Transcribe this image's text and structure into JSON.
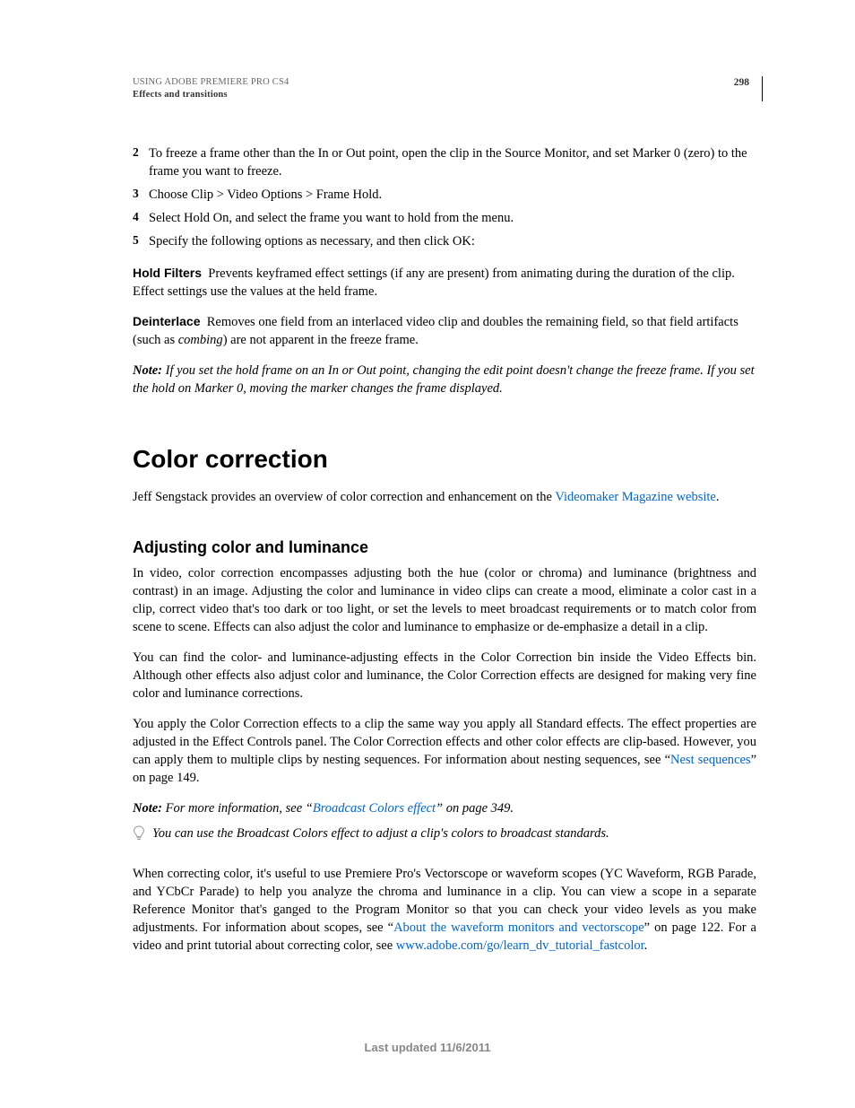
{
  "header": {
    "doc_title": "USING ADOBE PREMIERE PRO CS4",
    "section": "Effects and transitions",
    "page_number": "298"
  },
  "steps": {
    "s2": {
      "num": "2",
      "text": "To freeze a frame other than the In or Out point, open the clip in the Source Monitor, and set Marker 0 (zero) to the frame you want to freeze."
    },
    "s3": {
      "num": "3",
      "text": "Choose Clip > Video Options > Frame Hold."
    },
    "s4": {
      "num": "4",
      "text": "Select Hold On, and select the frame you want to hold from the menu."
    },
    "s5": {
      "num": "5",
      "text": "Specify the following options as necessary, and then click OK:"
    }
  },
  "defs": {
    "hold_filters": {
      "term": "Hold Filters",
      "body": "Prevents keyframed effect settings (if any are present) from animating during the duration of the clip. Effect settings use the values at the held frame."
    },
    "deinterlace": {
      "term": "Deinterlace",
      "body_a": "Removes one field from an interlaced video clip and doubles the remaining field, so that field artifacts (such as ",
      "body_i": "combing",
      "body_b": ") are not apparent in the freeze frame."
    }
  },
  "note1": {
    "label": "Note:",
    "text": " If you set the hold frame on an In or Out point, changing the edit point doesn't change the freeze frame. If you set the hold on Marker 0, moving the marker changes the frame displayed."
  },
  "h1": "Color correction",
  "intro": {
    "pre": "Jeff Sengstack provides an overview of color correction and enhancement on the ",
    "link": "Videomaker Magazine website",
    "post": "."
  },
  "h2": "Adjusting color and luminance",
  "p1": "In video, color correction encompasses adjusting both the hue (color or chroma) and luminance (brightness and contrast) in an image. Adjusting the color and luminance in video clips can create a mood, eliminate a color cast in a clip, correct video that's too dark or too light, or set the levels to meet broadcast requirements or to match color from scene to scene. Effects can also adjust the color and luminance to emphasize or de-emphasize a detail in a clip.",
  "p2": "You can find the color- and luminance-adjusting effects in the Color Correction bin inside the Video Effects bin. Although other effects also adjust color and luminance, the Color Correction effects are designed for making very fine color and luminance corrections.",
  "p3": {
    "a": "You apply the Color Correction effects to a clip the same way you apply all Standard effects. The effect properties are adjusted in the Effect Controls panel. The Color Correction effects and other color effects are clip-based. However, you can apply them to multiple clips by nesting sequences. For information about nesting sequences, see “",
    "link": "Nest sequences",
    "b": "” on page 149."
  },
  "note2": {
    "label": "Note:",
    "a": " For more information, see “",
    "link": "Broadcast Colors effect",
    "b": "” on page 349."
  },
  "tip": "You can use the Broadcast Colors effect to adjust a clip's colors to broadcast standards.",
  "p4": {
    "a": "When correcting color, it's useful to use Premiere Pro's Vectorscope or waveform scopes (YC Waveform, RGB Parade, and YCbCr Parade) to help you analyze the chroma and luminance in a clip. You can view a scope in a separate Reference Monitor that's ganged to the Program Monitor so that you can check your video levels as you make adjustments. For information about scopes, see “",
    "link1": "About the waveform monitors and vectorscope",
    "b": "” on page 122. For a video and print tutorial about correcting color, see ",
    "link2": "www.adobe.com/go/learn_dv_tutorial_fastcolor",
    "c": "."
  },
  "footer": "Last updated 11/6/2011"
}
